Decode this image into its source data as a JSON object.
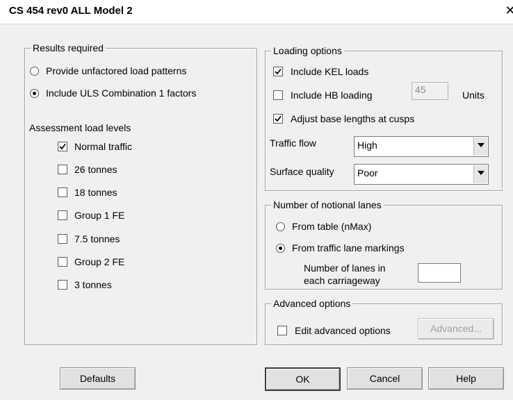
{
  "window": {
    "title": "CS 454 rev0 ALL Model 2",
    "close_label": "✕"
  },
  "results": {
    "legend": "Results required",
    "radio_unfactored": "Provide unfactored load patterns",
    "radio_uls": "Include ULS Combination 1 factors",
    "selected": "Include ULS Combination 1 factors",
    "assessment_label": "Assessment load levels",
    "levels": [
      {
        "label": "Normal traffic",
        "checked": true
      },
      {
        "label": "26 tonnes",
        "checked": false
      },
      {
        "label": "18 tonnes",
        "checked": false
      },
      {
        "label": "Group 1 FE",
        "checked": false
      },
      {
        "label": "7.5 tonnes",
        "checked": false
      },
      {
        "label": "Group 2 FE",
        "checked": false
      },
      {
        "label": "3 tonnes",
        "checked": false
      }
    ]
  },
  "loading": {
    "legend": "Loading options",
    "kel_label": "Include KEL loads",
    "kel_checked": true,
    "hb_label": "Include HB loading",
    "hb_checked": false,
    "hb_units_value": "45",
    "units_label": "Units",
    "adjust_label": "Adjust base lengths at cusps",
    "adjust_checked": true,
    "traffic_flow_label": "Traffic flow",
    "traffic_flow_value": "High",
    "surface_quality_label": "Surface quality",
    "surface_quality_value": "Poor"
  },
  "lanes": {
    "legend": "Number of notional lanes",
    "radio_table": "From table (nMax)",
    "radio_markings": "From traffic lane markings",
    "selected": "From traffic lane markings",
    "lanes_label_line1": "Number of lanes in",
    "lanes_label_line2": "each carriageway",
    "lanes_value": ""
  },
  "advanced": {
    "legend": "Advanced options",
    "edit_label": "Edit advanced options",
    "edit_checked": false,
    "button_label": "Advanced..."
  },
  "buttons": {
    "defaults": "Defaults",
    "ok": "OK",
    "cancel": "Cancel",
    "help": "Help"
  }
}
